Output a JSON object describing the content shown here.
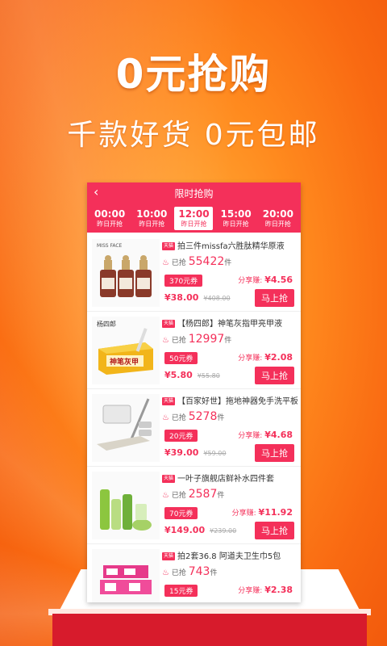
{
  "hero": {
    "title": "0元抢购",
    "subtitle": "千款好货 0元包邮"
  },
  "app": {
    "back_glyph": "‹",
    "title": "限时抢购",
    "accent": "#f4305a"
  },
  "time_slots": [
    {
      "time": "00:00",
      "status": "昨日开抢",
      "active": false
    },
    {
      "time": "10:00",
      "status": "昨日开抢",
      "active": false
    },
    {
      "time": "12:00",
      "status": "昨日开抢",
      "active": true
    },
    {
      "time": "15:00",
      "status": "昨日开抢",
      "active": false
    },
    {
      "time": "20:00",
      "status": "昨日开抢",
      "active": false
    }
  ],
  "products": [
    {
      "tag": "天猫",
      "title": "拍三件missfa六胜肽精华原液",
      "sold_prefix": "已抢",
      "sold_count": "55422",
      "sold_unit": "件",
      "coupon": "370元券",
      "share_label": "分享赚: ",
      "share_value": "¥4.56",
      "price": "¥38.00",
      "original_price": "¥408.00",
      "buy_label": "马上抢",
      "thumb_brand": "MISS FACE",
      "thumb": "serum-bottles"
    },
    {
      "tag": "天猫",
      "title": "【杨四郎】神笔灰指甲亮甲液",
      "sold_prefix": "已抢",
      "sold_count": "12997",
      "sold_unit": "件",
      "coupon": "50元券",
      "share_label": "分享赚: ",
      "share_value": "¥2.08",
      "price": "¥5.80",
      "original_price": "¥55.80",
      "buy_label": "马上抢",
      "thumb_brand": "杨四郎",
      "thumb_label": "神笔灰甲",
      "thumb": "nail-pen-box"
    },
    {
      "tag": "天猫",
      "title": "【百家好世】拖地神器免手洗平板拖",
      "sold_prefix": "已抢",
      "sold_count": "5278",
      "sold_unit": "件",
      "coupon": "20元券",
      "share_label": "分享赚: ",
      "share_value": "¥4.68",
      "price": "¥39.00",
      "original_price": "¥59.00",
      "buy_label": "马上抢",
      "thumb": "flat-mop"
    },
    {
      "tag": "天猫",
      "title": "一叶子旗舰店鲜补水四件套",
      "sold_prefix": "已抢",
      "sold_count": "2587",
      "sold_unit": "件",
      "coupon": "70元券",
      "share_label": "分享赚: ",
      "share_value": "¥11.92",
      "price": "¥149.00",
      "original_price": "¥239.00",
      "buy_label": "马上抢",
      "thumb": "skincare-set"
    },
    {
      "tag": "天猫",
      "title": "拍2套36.8 阿道夫卫生巾5包",
      "sold_prefix": "已抢",
      "sold_count": "743",
      "sold_unit": "件",
      "coupon": "15元券",
      "share_label": "分享赚: ",
      "share_value": "¥2.38",
      "price": "",
      "original_price": "",
      "buy_label": "",
      "thumb": "pad-packs"
    }
  ]
}
